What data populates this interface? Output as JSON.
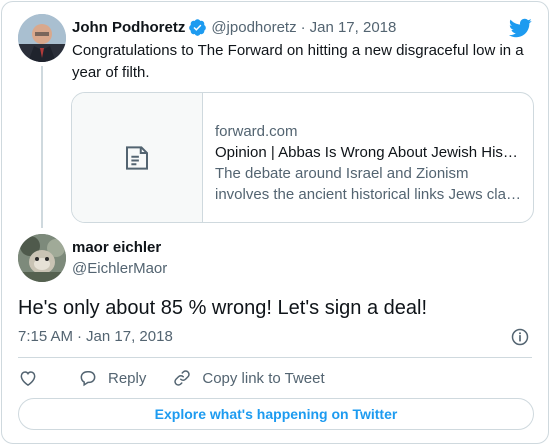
{
  "quoted_tweet": {
    "author_name": "John Podhoretz",
    "handle": "@jpodhoretz",
    "separator": "·",
    "date": "Jan 17, 2018",
    "text": "Congratulations to The Forward on hitting a new disgraceful low in a year of filth.",
    "link_card": {
      "domain": "forward.com",
      "title": "Opinion | Abbas Is Wrong About Jewish His…",
      "description_line1": "The debate around Israel and Zionism",
      "description_line2": "involves the ancient historical links Jews cla…",
      "thumbnail_icon": "document-icon"
    }
  },
  "tweet": {
    "author_name": "maor eichler",
    "handle": "@EichlerMaor",
    "text": "He's only about 85 % wrong! Let's sign a deal!",
    "time": "7:15 AM",
    "separator": "·",
    "date": "Jan 17, 2018"
  },
  "actions": {
    "like_icon": "heart-icon",
    "reply_label": "Reply",
    "copy_link_label": "Copy link to Tweet"
  },
  "explore_label": "Explore what's happening on Twitter",
  "colors": {
    "accent": "#1d9bf0",
    "text": "#0f1419",
    "muted": "#536471",
    "border": "#cfd9de"
  }
}
